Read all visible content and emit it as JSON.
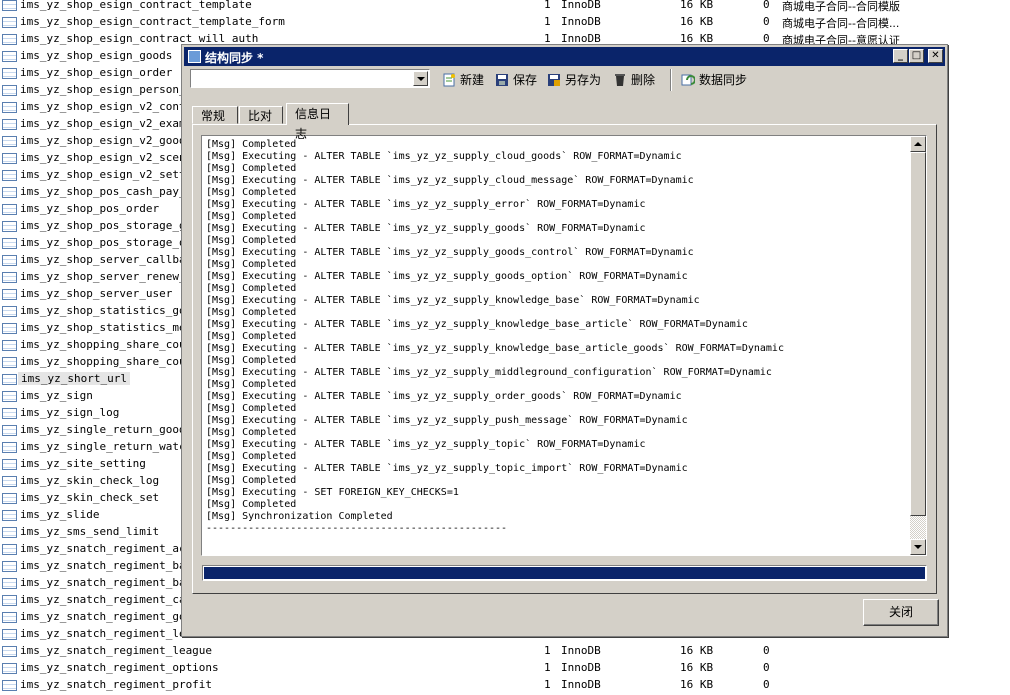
{
  "background_tables": [
    {
      "name": "ims_yz_shop_esign_contract_template",
      "rows": "1",
      "engine": "InnoDB",
      "size": "16 KB",
      "free": "0",
      "comment": "商城电子合同--合同模版"
    },
    {
      "name": "ims_yz_shop_esign_contract_template_form",
      "rows": "1",
      "engine": "InnoDB",
      "size": "16 KB",
      "free": "0",
      "comment": "商城电子合同--合同模..."
    },
    {
      "name": "ims_yz_shop_esign_contract_will_auth",
      "rows": "1",
      "engine": "InnoDB",
      "size": "16 KB",
      "free": "0",
      "comment": "商城电子合同--意愿认证"
    },
    {
      "name": "ims_yz_shop_esign_goods"
    },
    {
      "name": "ims_yz_shop_esign_order"
    },
    {
      "name": "ims_yz_shop_esign_person_ac"
    },
    {
      "name": "ims_yz_shop_esign_v2_contra"
    },
    {
      "name": "ims_yz_shop_esign_v2_examin"
    },
    {
      "name": "ims_yz_shop_esign_v2_goods"
    },
    {
      "name": "ims_yz_shop_esign_v2_scene"
    },
    {
      "name": "ims_yz_shop_esign_v2_settin"
    },
    {
      "name": "ims_yz_shop_pos_cash_pay_lo"
    },
    {
      "name": "ims_yz_shop_pos_order"
    },
    {
      "name": "ims_yz_shop_pos_storage_goo"
    },
    {
      "name": "ims_yz_shop_pos_storage_ord"
    },
    {
      "name": "ims_yz_shop_server_callback"
    },
    {
      "name": "ims_yz_shop_server_renew_lo"
    },
    {
      "name": "ims_yz_shop_server_user"
    },
    {
      "name": "ims_yz_shop_statistics_good"
    },
    {
      "name": "ims_yz_shop_statistics_memb"
    },
    {
      "name": "ims_yz_shopping_share_coupo"
    },
    {
      "name": "ims_yz_shopping_share_coupo"
    },
    {
      "name": "ims_yz_short_url",
      "selected": true
    },
    {
      "name": "ims_yz_sign"
    },
    {
      "name": "ims_yz_sign_log"
    },
    {
      "name": "ims_yz_single_return_goods"
    },
    {
      "name": "ims_yz_single_return_watch_"
    },
    {
      "name": "ims_yz_site_setting"
    },
    {
      "name": "ims_yz_skin_check_log"
    },
    {
      "name": "ims_yz_skin_check_set"
    },
    {
      "name": "ims_yz_slide"
    },
    {
      "name": "ims_yz_sms_send_limit"
    },
    {
      "name": "ims_yz_snatch_regiment_acti"
    },
    {
      "name": "ims_yz_snatch_regiment_bart"
    },
    {
      "name": "ims_yz_snatch_regiment_basi"
    },
    {
      "name": "ims_yz_snatch_regiment_cate"
    },
    {
      "name": "ims_yz_snatch_regiment_good"
    },
    {
      "name": "ims_yz_snatch_regiment_lead"
    },
    {
      "name": "ims_yz_snatch_regiment_league",
      "rows": "1",
      "engine": "InnoDB",
      "size": "16 KB",
      "free": "0"
    },
    {
      "name": "ims_yz_snatch_regiment_options",
      "rows": "1",
      "engine": "InnoDB",
      "size": "16 KB",
      "free": "0"
    },
    {
      "name": "ims_yz_snatch_regiment_profit",
      "rows": "1",
      "engine": "InnoDB",
      "size": "16 KB",
      "free": "0"
    }
  ],
  "dialog": {
    "title": "结构同步 *",
    "window_buttons": {
      "minimize": "_",
      "maximize": "□",
      "close": "✕"
    },
    "toolbar": {
      "combo_value": "",
      "new_label": "新建",
      "save_label": "保存",
      "saveas_label": "另存为",
      "delete_label": "删除",
      "sync_label": "数据同步"
    },
    "tabs": {
      "general": "常规",
      "compare": "比对",
      "log": "信息日志"
    },
    "active_tab": "log",
    "log_lines": [
      "[Msg] Completed",
      "[Msg] Executing - ALTER TABLE `ims_yz_yz_supply_cloud_goods` ROW_FORMAT=Dynamic",
      "[Msg] Completed",
      "[Msg] Executing - ALTER TABLE `ims_yz_yz_supply_cloud_message` ROW_FORMAT=Dynamic",
      "[Msg] Completed",
      "[Msg] Executing - ALTER TABLE `ims_yz_yz_supply_error` ROW_FORMAT=Dynamic",
      "[Msg] Completed",
      "[Msg] Executing - ALTER TABLE `ims_yz_yz_supply_goods` ROW_FORMAT=Dynamic",
      "[Msg] Completed",
      "[Msg] Executing - ALTER TABLE `ims_yz_yz_supply_goods_control` ROW_FORMAT=Dynamic",
      "[Msg] Completed",
      "[Msg] Executing - ALTER TABLE `ims_yz_yz_supply_goods_option` ROW_FORMAT=Dynamic",
      "[Msg] Completed",
      "[Msg] Executing - ALTER TABLE `ims_yz_yz_supply_knowledge_base` ROW_FORMAT=Dynamic",
      "[Msg] Completed",
      "[Msg] Executing - ALTER TABLE `ims_yz_yz_supply_knowledge_base_article` ROW_FORMAT=Dynamic",
      "[Msg] Completed",
      "[Msg] Executing - ALTER TABLE `ims_yz_yz_supply_knowledge_base_article_goods` ROW_FORMAT=Dynamic",
      "[Msg] Completed",
      "[Msg] Executing - ALTER TABLE `ims_yz_yz_supply_middleground_configuration` ROW_FORMAT=Dynamic",
      "[Msg] Completed",
      "[Msg] Executing - ALTER TABLE `ims_yz_yz_supply_order_goods` ROW_FORMAT=Dynamic",
      "[Msg] Completed",
      "[Msg] Executing - ALTER TABLE `ims_yz_yz_supply_push_message` ROW_FORMAT=Dynamic",
      "[Msg] Completed",
      "[Msg] Executing - ALTER TABLE `ims_yz_yz_supply_topic` ROW_FORMAT=Dynamic",
      "[Msg] Completed",
      "[Msg] Executing - ALTER TABLE `ims_yz_yz_supply_topic_import` ROW_FORMAT=Dynamic",
      "[Msg] Completed",
      "[Msg] Executing - SET FOREIGN_KEY_CHECKS=1",
      "[Msg] Completed",
      "[Msg] Synchronization Completed",
      "--------------------------------------------------"
    ],
    "progress": 1.0,
    "close_label": "关闭"
  },
  "colors": {
    "titlebar": "#0a246a",
    "face": "#d4d0c8",
    "progress": "#0a246a"
  }
}
